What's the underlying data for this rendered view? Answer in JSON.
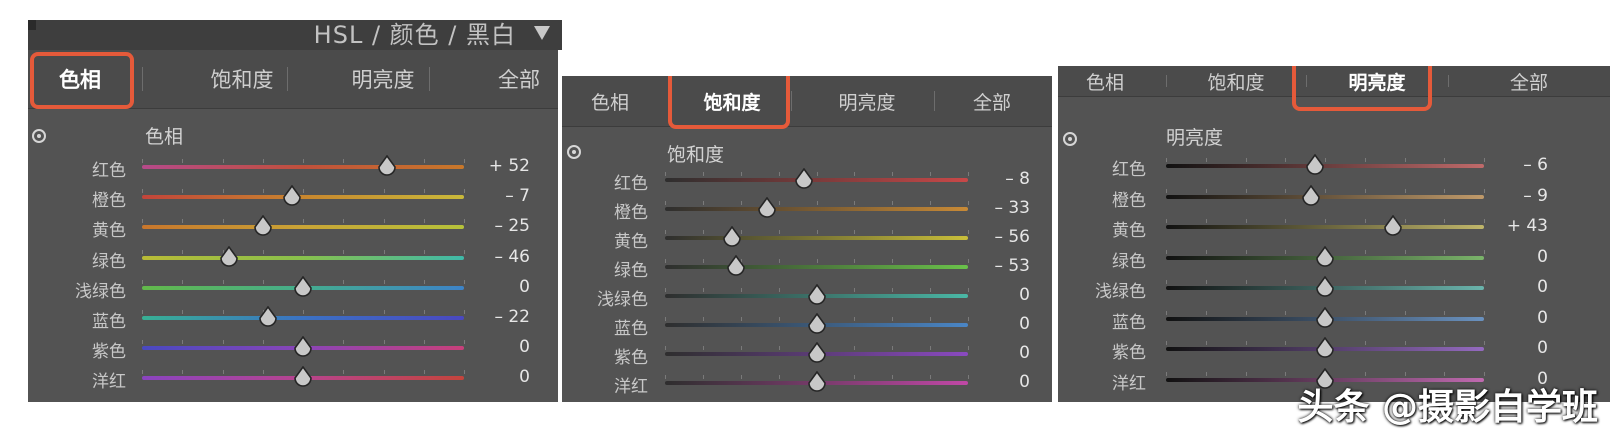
{
  "header": {
    "title": "HSL / 颜色 / 黑白"
  },
  "watermark": "头条 @摄影自学班",
  "panels": [
    {
      "tabs": [
        "色相",
        "饱和度",
        "明亮度",
        "全部"
      ],
      "active_tab": 0,
      "section_title": "色相",
      "rows": [
        {
          "label": "红色",
          "value": "+ 52",
          "num": 52
        },
        {
          "label": "橙色",
          "value": "– 7",
          "num": -7
        },
        {
          "label": "黄色",
          "value": "– 25",
          "num": -25
        },
        {
          "label": "绿色",
          "value": "– 46",
          "num": -46
        },
        {
          "label": "浅绿色",
          "value": "0",
          "num": 0
        },
        {
          "label": "蓝色",
          "value": "– 22",
          "num": -22
        },
        {
          "label": "紫色",
          "value": "0",
          "num": 0
        },
        {
          "label": "洋红",
          "value": "0",
          "num": 0
        }
      ]
    },
    {
      "tabs": [
        "色相",
        "饱和度",
        "明亮度",
        "全部"
      ],
      "active_tab": 1,
      "section_title": "饱和度",
      "rows": [
        {
          "label": "红色",
          "value": "– 8",
          "num": -8
        },
        {
          "label": "橙色",
          "value": "– 33",
          "num": -33
        },
        {
          "label": "黄色",
          "value": "– 56",
          "num": -56
        },
        {
          "label": "绿色",
          "value": "– 53",
          "num": -53
        },
        {
          "label": "浅绿色",
          "value": "0",
          "num": 0
        },
        {
          "label": "蓝色",
          "value": "0",
          "num": 0
        },
        {
          "label": "紫色",
          "value": "0",
          "num": 0
        },
        {
          "label": "洋红",
          "value": "0",
          "num": 0
        }
      ]
    },
    {
      "tabs": [
        "色相",
        "饱和度",
        "明亮度",
        "全部"
      ],
      "active_tab": 2,
      "section_title": "明亮度",
      "rows": [
        {
          "label": "红色",
          "value": "– 6",
          "num": -6
        },
        {
          "label": "橙色",
          "value": "– 9",
          "num": -9
        },
        {
          "label": "黄色",
          "value": "+ 43",
          "num": 43
        },
        {
          "label": "绿色",
          "value": "0",
          "num": 0
        },
        {
          "label": "浅绿色",
          "value": "0",
          "num": 0
        },
        {
          "label": "蓝色",
          "value": "0",
          "num": 0
        },
        {
          "label": "紫色",
          "value": "0",
          "num": 0
        },
        {
          "label": "洋红",
          "value": "0",
          "num": 0
        }
      ]
    }
  ],
  "colors": {
    "highlight": "#e55a3a",
    "hue_gradients": [
      [
        "#b64a8a",
        "#c0503c",
        "#c8782a"
      ],
      [
        "#c2443a",
        "#c8862e",
        "#c9b93a"
      ],
      [
        "#c8762c",
        "#c9a436",
        "#b6c23a"
      ],
      [
        "#b9bb36",
        "#88c14c",
        "#3fb9a9"
      ],
      [
        "#63b94a",
        "#44ad8e",
        "#3d83c8"
      ],
      [
        "#38b094",
        "#3b72c4",
        "#4a48c0"
      ],
      [
        "#4949c0",
        "#8a45b8",
        "#c8407a"
      ],
      [
        "#8a44c0",
        "#b8448e",
        "#c4443c"
      ]
    ],
    "saturation_ends": [
      "#c84848",
      "#c88a36",
      "#c9bf3a",
      "#6ac24a",
      "#4ab8a6",
      "#4a86c6",
      "#8a4ac0",
      "#c048a6"
    ],
    "luminance_ends": [
      "#c06a6a",
      "#c09a6a",
      "#c0b66a",
      "#7ab46a",
      "#6ab4ac",
      "#6a92c0",
      "#946ac0",
      "#c06ab0"
    ]
  }
}
